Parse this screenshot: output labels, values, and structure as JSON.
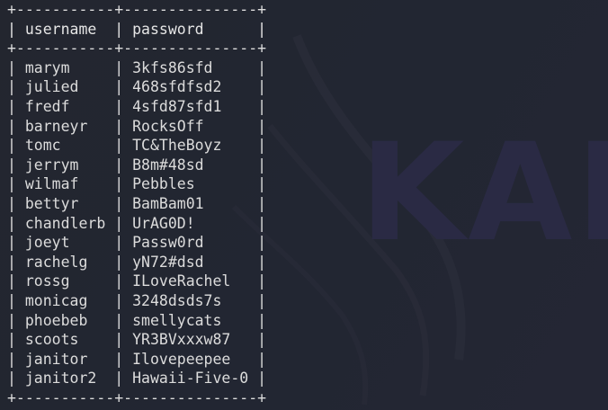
{
  "background": {
    "wordmark": "KALI",
    "colors": {
      "background": "#222631",
      "text": "#dcdcdc",
      "wordmark": "#2a2a44"
    }
  },
  "table": {
    "columns": [
      "username",
      "password"
    ],
    "rows": [
      [
        "marym",
        "3kfs86sfd"
      ],
      [
        "julied",
        "468sfdfsd2"
      ],
      [
        "fredf",
        "4sfd87sfd1"
      ],
      [
        "barneyr",
        "RocksOff"
      ],
      [
        "tomc",
        "TC&TheBoyz"
      ],
      [
        "jerrym",
        "B8m#48sd"
      ],
      [
        "wilmaf",
        "Pebbles"
      ],
      [
        "bettyr",
        "BamBam01"
      ],
      [
        "chandlerb",
        "UrAG0D!"
      ],
      [
        "joeyt",
        "Passw0rd"
      ],
      [
        "rachelg",
        "yN72#dsd"
      ],
      [
        "rossg",
        "ILoveRachel"
      ],
      [
        "monicag",
        "3248dsds7s"
      ],
      [
        "phoebeb",
        "smellycats"
      ],
      [
        "scoots",
        "YR3BVxxxw87"
      ],
      [
        "janitor",
        "Ilovepeepee"
      ],
      [
        "janitor2",
        "Hawaii-Five-0"
      ]
    ]
  }
}
